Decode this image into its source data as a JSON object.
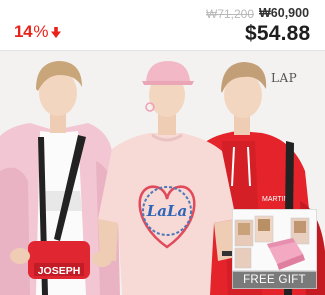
{
  "price": {
    "discount_value": "14",
    "discount_unit": "%",
    "original_price": "₩71,200",
    "sale_price_krw": "₩60,900",
    "sale_price_usd": "$54.88",
    "accent_color": "#e8231a"
  },
  "photo": {
    "brand_mark": "LAP",
    "bag_text": "JOSEPH",
    "shirt_graphic_text": "LaLa",
    "shirt_sleeve_text": "MARTIN"
  },
  "gift": {
    "label": "FREE GIFT"
  },
  "icons": {
    "discount_arrow": "arrow-down-icon",
    "gift_image": "free-gift-image"
  }
}
